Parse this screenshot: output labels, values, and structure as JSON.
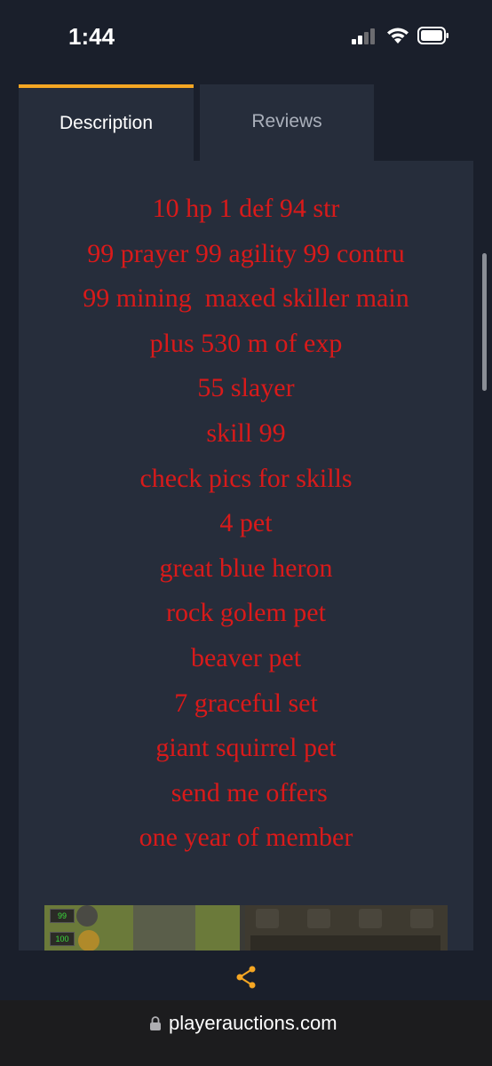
{
  "status_bar": {
    "time": "1:44"
  },
  "tabs": [
    {
      "label": "Description",
      "active": true
    },
    {
      "label": "Reviews",
      "active": false
    }
  ],
  "description": {
    "lines": [
      "10 hp 1 def 94 str",
      "99 prayer 99 agility 99 contru",
      "99 mining  maxed skiller main",
      "plus 530 m of exp",
      "55 slayer",
      "skill 99",
      "check pics for skills",
      "4 pet",
      "great blue heron",
      "rock golem pet",
      "beaver pet",
      "7 graceful set",
      "giant squirrel pet",
      " send me offers",
      "one year of member"
    ],
    "text_color": "#d91a1a"
  },
  "thumbnail": {
    "orb_values": [
      "99",
      "100"
    ]
  },
  "browser": {
    "url": "playerauctions.com",
    "share_icon": "share-icon",
    "lock_icon": "lock-icon"
  },
  "colors": {
    "accent": "#f5a623",
    "background": "#1a1f2b",
    "panel": "#262d3b"
  }
}
